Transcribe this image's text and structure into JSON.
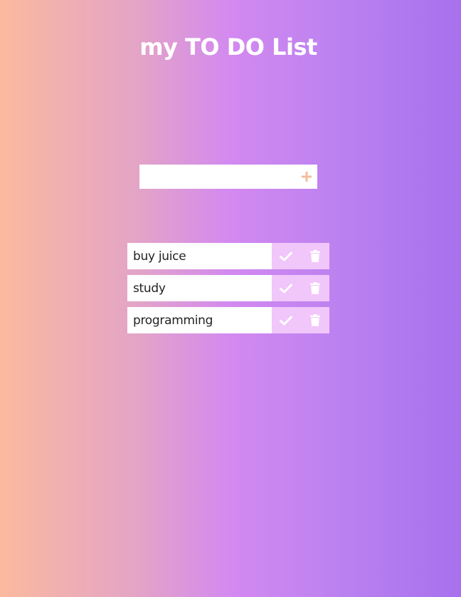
{
  "app": {
    "title": "my TO DO List"
  },
  "form": {
    "input_value": "",
    "input_placeholder": "",
    "add_icon": "plus-icon"
  },
  "todos": [
    {
      "text": "buy juice",
      "complete_icon": "check-icon",
      "delete_icon": "trash-icon"
    },
    {
      "text": "study",
      "complete_icon": "check-icon",
      "delete_icon": "trash-icon"
    },
    {
      "text": "programming",
      "complete_icon": "check-icon",
      "delete_icon": "trash-icon"
    }
  ],
  "colors": {
    "gradient_left": "#fbb99e",
    "gradient_mid": "#d389f0",
    "gradient_right": "#a771ee",
    "add_icon": "#f4bd9d",
    "action_bg": "#f1c6fa",
    "action_icon": "#ffffff"
  }
}
